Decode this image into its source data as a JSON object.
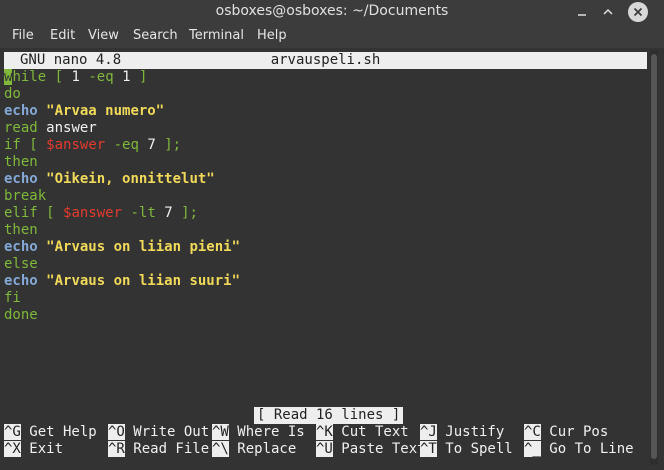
{
  "window": {
    "title": "osboxes@osboxes: ~/Documents"
  },
  "menu": [
    "File",
    "Edit",
    "View",
    "Search",
    "Terminal",
    "Help"
  ],
  "nano": {
    "version": "GNU nano 4.8",
    "filename": "arvauspeli.sh",
    "status": "[ Read 16 lines ]"
  },
  "code_lines": [
    "while [ 1 -eq 1 ]",
    "do",
    "echo \"Arvaa numero\"",
    "read answer",
    "if [ $answer -eq 7 ];",
    "then",
    "echo \"Oikein, onnittelut\"",
    "break",
    "elif [ $answer -lt 7 ];",
    "then",
    "echo \"Arvaus on liian pieni\"",
    "else",
    "echo \"Arvaus on liian suuri\"",
    "fi",
    "done"
  ],
  "shortcuts": [
    {
      "key": "^G",
      "label": "Get Help"
    },
    {
      "key": "^O",
      "label": "Write Out"
    },
    {
      "key": "^W",
      "label": "Where Is"
    },
    {
      "key": "^K",
      "label": "Cut Text"
    },
    {
      "key": "^J",
      "label": "Justify"
    },
    {
      "key": "^C",
      "label": "Cur Pos"
    },
    {
      "key": "^X",
      "label": "Exit"
    },
    {
      "key": "^R",
      "label": "Read File"
    },
    {
      "key": "^\\",
      "label": "Replace"
    },
    {
      "key": "^U",
      "label": "Paste Text"
    },
    {
      "key": "^T",
      "label": "To Spell"
    },
    {
      "key": "^_",
      "label": "Go To Line"
    }
  ],
  "colors": {
    "keyword": "#7fb83a",
    "echo": "#84a9d8",
    "string": "#f1d95a",
    "variable": "#e43a2f",
    "background": "#333333"
  },
  "icons": [
    "minimize-icon",
    "maximize-icon",
    "close-icon"
  ]
}
